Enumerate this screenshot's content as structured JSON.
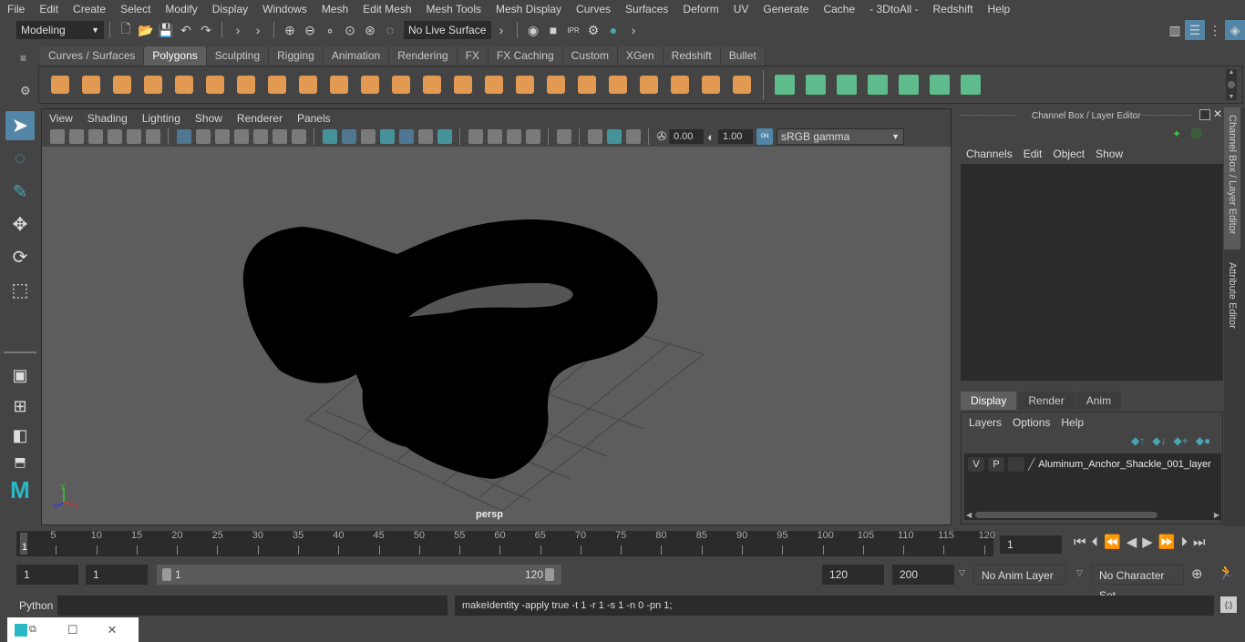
{
  "menubar": {
    "items": [
      "File",
      "Edit",
      "Create",
      "Select",
      "Modify",
      "Display",
      "Windows",
      "Mesh",
      "Edit Mesh",
      "Mesh Tools",
      "Mesh Display",
      "Curves",
      "Surfaces",
      "Deform",
      "UV",
      "Generate",
      "Cache",
      "- 3DtoAll -",
      "Redshift",
      "Help"
    ]
  },
  "statusline": {
    "mode": "Modeling",
    "live_surface": "No Live Surface"
  },
  "shelf": {
    "tabs": [
      "Curves / Surfaces",
      "Polygons",
      "Sculpting",
      "Rigging",
      "Animation",
      "Rendering",
      "FX",
      "FX Caching",
      "Custom",
      "XGen",
      "Redshift",
      "Bullet"
    ],
    "active_tab": "Polygons",
    "orange_icons": [
      "sphere",
      "cube",
      "cylinder",
      "cone",
      "plane",
      "torus",
      "pyramid",
      "pipe",
      "combine",
      "separate",
      "mirror",
      "smooth",
      "boolean",
      "extract",
      "bevel",
      "bridge",
      "extrude",
      "multi-cut",
      "target-weld",
      "bevel-edge",
      "fill-hole",
      "append",
      "merge"
    ],
    "green_icons": [
      "planar-uv",
      "cylindrical-uv",
      "spherical-uv",
      "automatic-uv",
      "unfold",
      "uv-editor",
      "layout"
    ]
  },
  "viewport": {
    "menu": [
      "View",
      "Shading",
      "Lighting",
      "Show",
      "Renderer",
      "Panels"
    ],
    "exposure": "0.00",
    "gamma": "1.00",
    "color_space": "sRGB gamma",
    "camera_label": "persp",
    "axis": {
      "x": "x",
      "y": "y",
      "z": "z"
    }
  },
  "channel_box": {
    "title": "Channel Box / Layer Editor",
    "menu": [
      "Channels",
      "Edit",
      "Object",
      "Show"
    ]
  },
  "layer_editor": {
    "tabs": [
      "Display",
      "Render",
      "Anim"
    ],
    "active_tab": "Display",
    "menu": [
      "Layers",
      "Options",
      "Help"
    ],
    "layers": [
      {
        "v": "V",
        "p": "P",
        "name": "Aluminum_Anchor_Shackle_001_layer"
      }
    ]
  },
  "side_tabs": [
    "Channel Box / Layer Editor",
    "Attribute Editor"
  ],
  "timeline": {
    "ticks": [
      5,
      10,
      15,
      20,
      25,
      30,
      35,
      40,
      45,
      50,
      55,
      60,
      65,
      70,
      75,
      80,
      85,
      90,
      95,
      100,
      105,
      110,
      115,
      120
    ],
    "current_marker": "1",
    "current_frame": "1"
  },
  "range": {
    "start": "1",
    "playback_start": "1",
    "slider_start": "1",
    "slider_end": "120",
    "playback_end": "120",
    "end": "200",
    "anim_layer": "No Anim Layer",
    "character_set": "No Character Set"
  },
  "command": {
    "language": "Python",
    "input": "",
    "result": "makeIdentity -apply true -t 1 -r 1 -s 1 -n 0 -pn 1;"
  },
  "colors": {
    "accent_blue": "#5285a6",
    "shelf_orange": "#e29a53",
    "shelf_green": "#5dbb8c",
    "teal": "#47a6b2"
  }
}
